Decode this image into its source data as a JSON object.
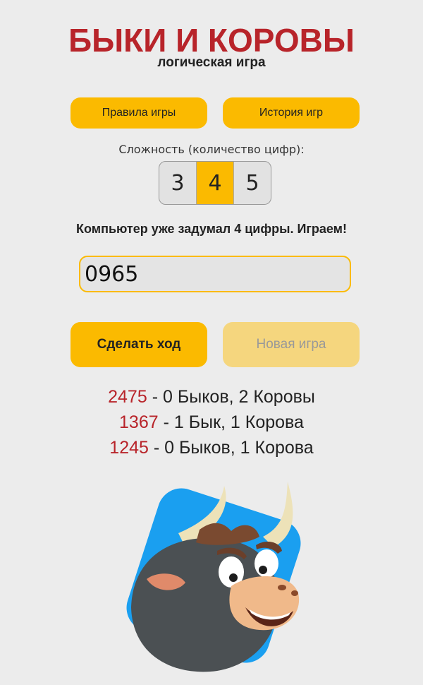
{
  "header": {
    "title": "БЫКИ И КОРОВЫ",
    "subtitle": "логическая игра"
  },
  "buttons": {
    "rules": "Правила игры",
    "history": "История игр",
    "make_move": "Сделать ход",
    "new_game": "Новая игра"
  },
  "difficulty": {
    "label": "Сложность (количество цифр):",
    "options": [
      "3",
      "4",
      "5"
    ],
    "selected": "4"
  },
  "status": "Компьютер уже задумал 4 цифры. Играем!",
  "guess_input": {
    "value": "0965"
  },
  "history": [
    {
      "number": "2475",
      "result": " - 0 Быков, 2 Коровы"
    },
    {
      "number": "1367",
      "result": " - 1 Бык, 1 Корова"
    },
    {
      "number": "1245",
      "result": " - 0 Быков, 1 Корова"
    }
  ],
  "colors": {
    "accent": "#fbba00",
    "title": "#b8242a",
    "disabled_button": "#f5d67e",
    "background": "#ececec"
  },
  "mascot": "bull-mascot-icon"
}
